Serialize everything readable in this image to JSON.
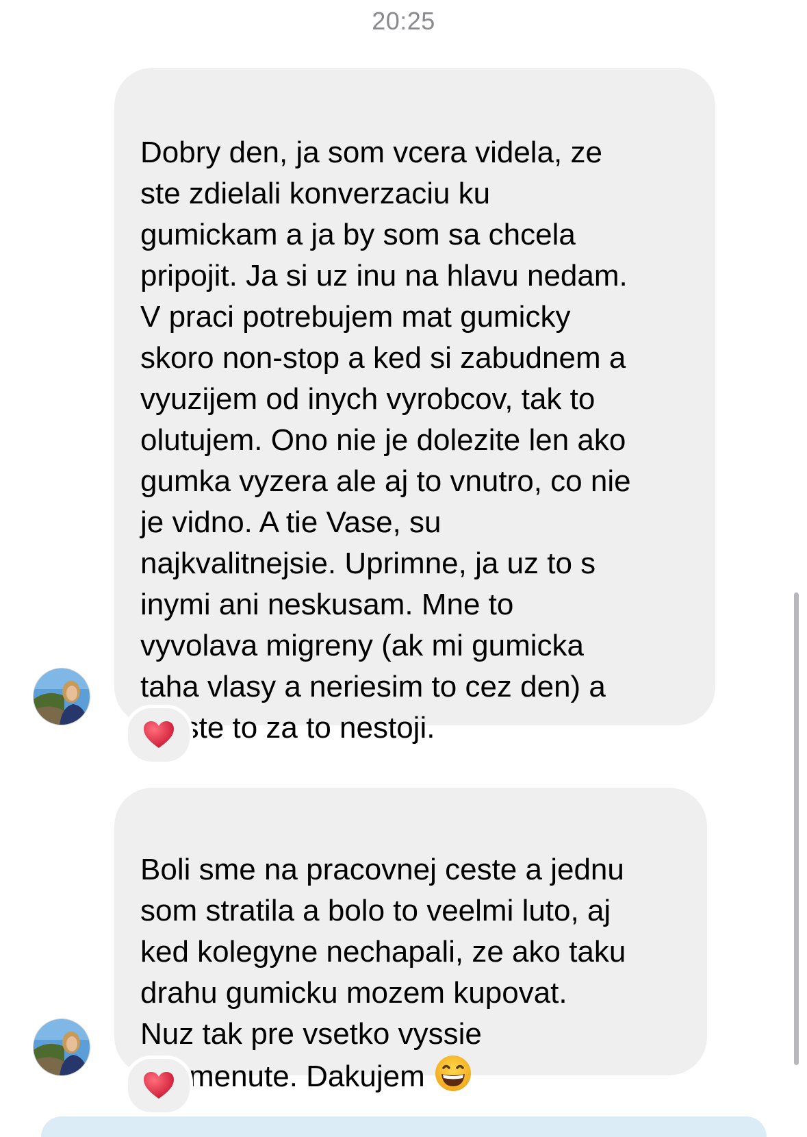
{
  "conversation": {
    "timestamp": "20:25",
    "messages": [
      {
        "text": "Dobry den, ja som vcera videla, ze\nste zdielali konverzaciu ku\ngumickam a ja by som sa chcela\npripojit. Ja si uz inu na hlavu nedam.\nV praci potrebujem mat gumicky\nskoro non-stop a ked si zabudnem a\nvyuzijem od inych vyrobcov, tak to\nolutujem. Ono nie je dolezite len ako\ngumka vyzera ale aj to vnutro, co nie\nje vidno. A tie Vase, su\nnajkvalitnejsie. Uprimne, ja uz to s\ninymi ani neskusam. Mne to\nvyvolava migreny (ak mi gumicka\ntaha vlasy a neriesim to cez den) a\nproste to za to nestoji.",
        "reaction": "heart-emoji"
      },
      {
        "text": "Boli sme na pracovnej ceste a jednu\nsom stratila a bolo to veelmi luto, aj\nked kolegyne nechapali, ze ako taku\ndrahu gumicku mozem kupovat.\nNuz tak pre vsetko vyssie\nspomenute.  Dakujem",
        "trailing_emoji": "grinning-face-emoji",
        "reaction": "heart-emoji"
      }
    ]
  },
  "colors": {
    "bubble_background": "#efefef",
    "timestamp": "#8a8a8e",
    "heart": "#e0243a",
    "emoji_face": "#f7c52b"
  }
}
